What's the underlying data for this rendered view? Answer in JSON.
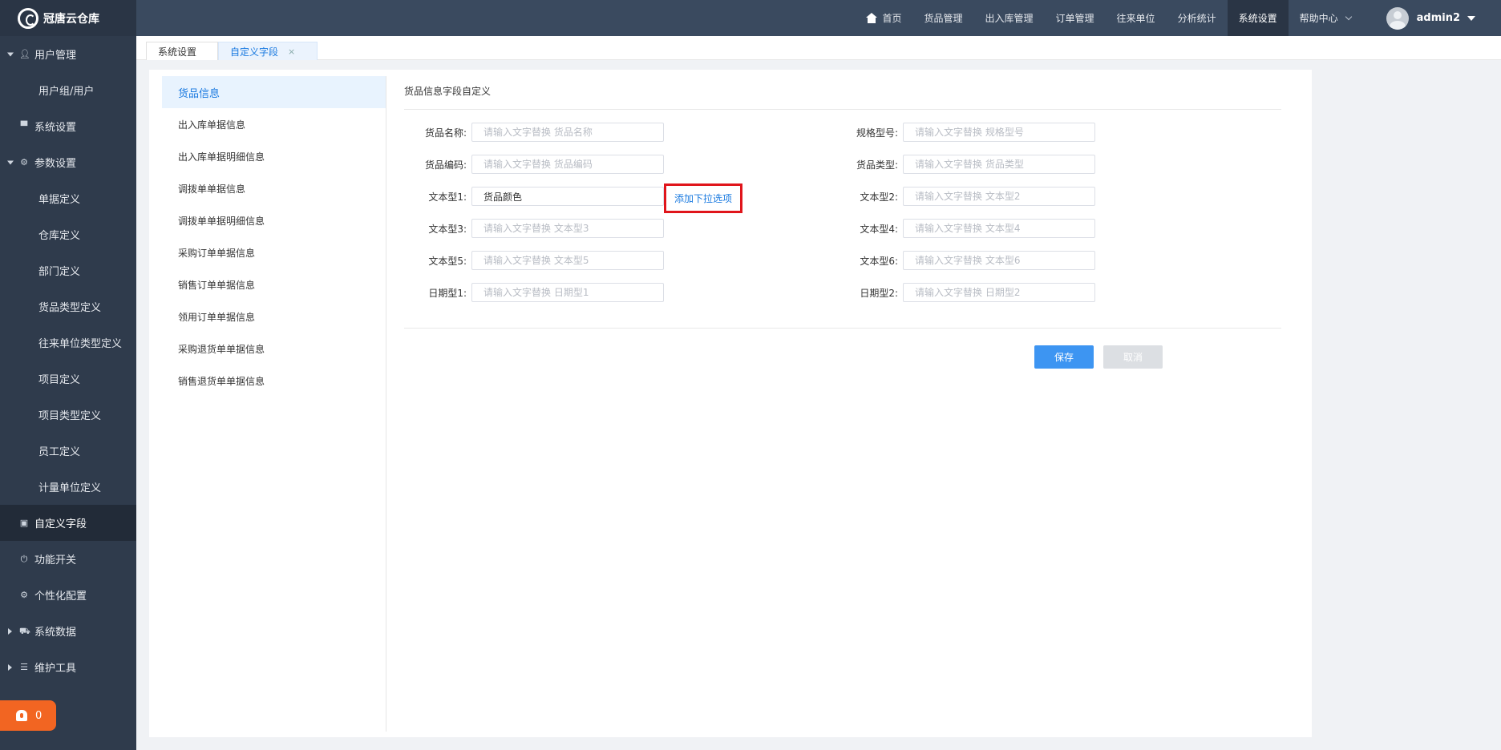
{
  "app": {
    "title": "冠唐云仓库"
  },
  "sidebar": {
    "items": [
      {
        "label": "用户管理"
      },
      {
        "label": "用户组/用户"
      },
      {
        "label": "系统设置"
      },
      {
        "label": "参数设置"
      },
      {
        "label": "单据定义"
      },
      {
        "label": "仓库定义"
      },
      {
        "label": "部门定义"
      },
      {
        "label": "货品类型定义"
      },
      {
        "label": "往来单位类型定义"
      },
      {
        "label": "项目定义"
      },
      {
        "label": "项目类型定义"
      },
      {
        "label": "员工定义"
      },
      {
        "label": "计量单位定义"
      },
      {
        "label": "自定义字段"
      },
      {
        "label": "功能开关"
      },
      {
        "label": "个性化配置"
      },
      {
        "label": "系统数据"
      },
      {
        "label": "维护工具"
      }
    ],
    "alert_count": "0"
  },
  "topnav": {
    "items": [
      {
        "label": "首页"
      },
      {
        "label": "货品管理"
      },
      {
        "label": "出入库管理"
      },
      {
        "label": "订单管理"
      },
      {
        "label": "往来单位"
      },
      {
        "label": "分析统计"
      },
      {
        "label": "系统设置"
      },
      {
        "label": "帮助中心"
      }
    ],
    "user": "admin2"
  },
  "tabs": [
    {
      "label": "系统设置"
    },
    {
      "label": "自定义字段",
      "close": "×"
    }
  ],
  "left_list": [
    "货品信息",
    "出入库单据信息",
    "出入库单据明细信息",
    "调拨单单据信息",
    "调拨单单据明细信息",
    "采购订单单据信息",
    "销售订单单据信息",
    "领用订单单据信息",
    "采购退货单单据信息",
    "销售退货单单据信息"
  ],
  "form": {
    "title": "货品信息字段自定义",
    "fields": [
      {
        "label": "货品名称:",
        "value": "",
        "placeholder": "请输入文字替换 货品名称"
      },
      {
        "label": "规格型号:",
        "value": "",
        "placeholder": "请输入文字替换 规格型号"
      },
      {
        "label": "货品编码:",
        "value": "",
        "placeholder": "请输入文字替换 货品编码"
      },
      {
        "label": "货品类型:",
        "value": "",
        "placeholder": "请输入文字替换 货品类型"
      },
      {
        "label": "文本型1:",
        "value": "货品颜色",
        "placeholder": ""
      },
      {
        "label": "文本型2:",
        "value": "",
        "placeholder": "请输入文字替换 文本型2"
      },
      {
        "label": "文本型3:",
        "value": "",
        "placeholder": "请输入文字替换 文本型3"
      },
      {
        "label": "文本型4:",
        "value": "",
        "placeholder": "请输入文字替换 文本型4"
      },
      {
        "label": "文本型5:",
        "value": "",
        "placeholder": "请输入文字替换 文本型5"
      },
      {
        "label": "文本型6:",
        "value": "",
        "placeholder": "请输入文字替换 文本型6"
      },
      {
        "label": "日期型1:",
        "value": "",
        "placeholder": "请输入文字替换 日期型1"
      },
      {
        "label": "日期型2:",
        "value": "",
        "placeholder": "请输入文字替换 日期型2"
      }
    ],
    "add_dropdown": "添加下拉选项",
    "save": "保存",
    "cancel": "取消"
  },
  "colors": {
    "sidebar_bg": "#2f3b4c",
    "topbar_bg": "#3a4a5f",
    "accent": "#1a7ae0",
    "highlight_border": "#e0151b",
    "save_bg": "#3d95f2",
    "alert_bg": "#f26522"
  }
}
